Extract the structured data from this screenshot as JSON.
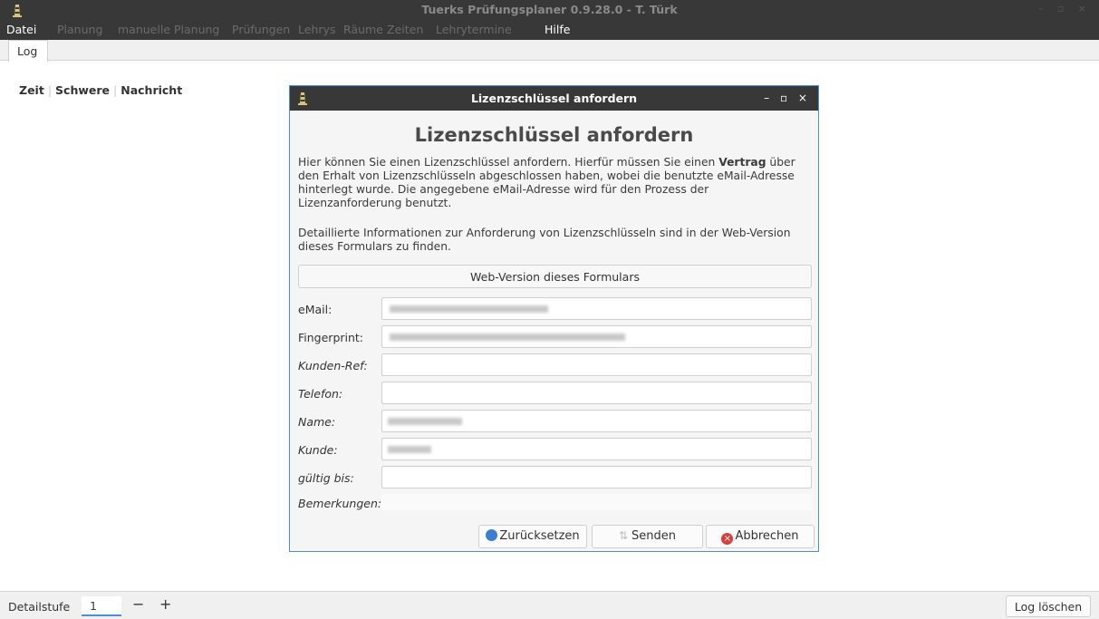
{
  "window": {
    "title": "Tuerks Prüfungsplaner 0.9.28.0 - T. Türk",
    "controls": "– ▫ ×"
  },
  "menu": {
    "items": [
      "Datei",
      "Planung",
      "manuelle Planung",
      "Prüfungen",
      "Lehrys",
      "Räume",
      "Zeiten",
      "Lehrytermine",
      "Hilfe"
    ]
  },
  "tabs": {
    "log": "Log"
  },
  "log_table": {
    "columns": [
      "Zeit",
      "Schwere",
      "Nachricht"
    ]
  },
  "bottom": {
    "detail_label": "Detailstufe",
    "detail_value": "1",
    "minus": "−",
    "plus": "+",
    "log_clear": "Log löschen"
  },
  "dialog": {
    "title": "Lizenzschlüssel anfordern",
    "controls": "– ▫ ×",
    "heading": "Lizenzschlüssel anfordern",
    "para1_before": "Hier können Sie einen Lizenzschlüssel anfordern. Hierfür müssen Sie einen ",
    "para1_bold": "Vertrag",
    "para1_after": " über den Erhalt von Lizenzschlüsseln abgeschlossen haben, wobei die benutzte eMail-Adresse hinterlegt wurde. Die angegebene eMail-Adresse wird für den Prozess der Lizenzanforderung benutzt.",
    "para2": "Detaillierte Informationen zur Anforderung von Lizenzschlüsseln sind in der Web-Version dieses Formulars zu finden.",
    "web_button": "Web-Version dieses Formulars",
    "fields": {
      "email": "eMail:",
      "fingerprint": "Fingerprint:",
      "kunden_ref": "Kunden-Ref:",
      "telefon": "Telefon:",
      "name": "Name:",
      "kunde": "Kunde:",
      "gueltig": "gültig bis:",
      "bemerkungen": "Bemerkungen:"
    },
    "buttons": {
      "reset": "Zurücksetzen",
      "send": "Senden",
      "cancel": "Abbrechen"
    }
  },
  "colors": {
    "accent": "#4a90d9",
    "titlebar": "#383838",
    "cancel_icon": "#d9403a",
    "reset_icon": "#3d7fcf"
  }
}
